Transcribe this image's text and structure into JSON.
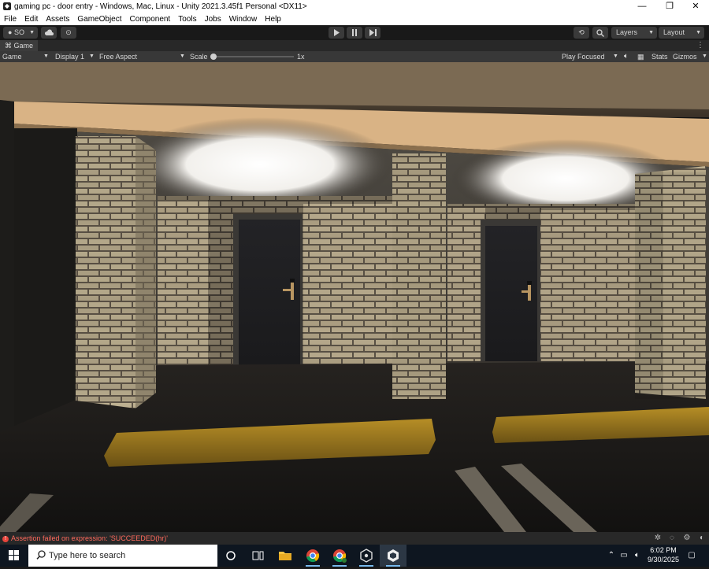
{
  "window": {
    "title": "gaming pc - door entry - Windows, Mac, Linux - Unity 2021.3.45f1 Personal <DX11>",
    "controls": {
      "minimize": "—",
      "maximize": "❐",
      "close": "✕"
    }
  },
  "menu": [
    "File",
    "Edit",
    "Assets",
    "GameObject",
    "Component",
    "Tools",
    "Jobs",
    "Window",
    "Help"
  ],
  "toolbar": {
    "account_label": "SO",
    "play_icons": [
      "play-icon",
      "pause-icon",
      "step-icon"
    ],
    "layers_label": "Layers",
    "layout_label": "Layout"
  },
  "game_view": {
    "tab_label": "Game",
    "mode_label": "Game",
    "display_label": "Display 1",
    "aspect_label": "Free Aspect",
    "scale_label": "Scale",
    "scale_value": "1x",
    "play_mode_label": "Play Focused",
    "stats_label": "Stats",
    "gizmos_label": "Gizmos"
  },
  "console": {
    "error_message": "Assertion failed on expression: 'SUCCEEDED(hr)'"
  },
  "taskbar": {
    "search_placeholder": "Type here to search",
    "apps": [
      "task-view-icon",
      "file-explorer-icon",
      "chrome-icon",
      "chrome-profile-icon",
      "unity-hub-icon",
      "unity-editor-icon"
    ],
    "time": "6:02 PM",
    "date": "9/30/2025"
  },
  "colors": {
    "editor_bg": "#191919",
    "error_red": "#e8453c",
    "brick": "#b3a688",
    "door": "#1c1c1e",
    "curb_yellow": "#9d7a1c",
    "ceiling_beam": "#d9b385",
    "light": "#ffffff"
  }
}
